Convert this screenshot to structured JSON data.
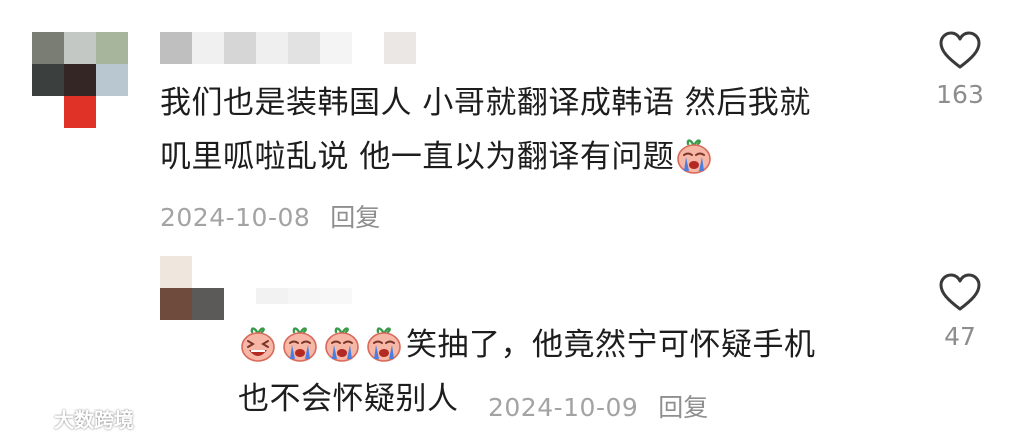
{
  "comment": {
    "avatar_pixels": [
      "#7a7d74",
      "#c4c8c5",
      "#a6b59b",
      "#3b3f3d",
      "#332624",
      "#b9c7d1",
      "#ffffff",
      "#e03226",
      "#ffffff"
    ],
    "name_pixels": [
      "#bfbfbf",
      "#f0f0f0",
      "#d6d6d6",
      "#efefef",
      "#e2e2e2",
      "#f4f4f4",
      "#ffffff",
      "#ebe7e4"
    ],
    "text_line1": "我们也是装韩国人 小哥就翻译成韩语 然后我就",
    "text_line2": "叽里呱啦乱说 他一直以为翻译有问题",
    "emoji_after_text": "crying-face-emoji",
    "date": "2024-10-08",
    "reply_label": "回复",
    "likes": "163",
    "like_icon": "heart-outline-icon"
  },
  "reply": {
    "avatar_pixels": [
      "#efe6dd",
      "#ffffff",
      "#6e4b3d",
      "#5c5a58"
    ],
    "name_pixels": [
      "#ffffff",
      "#f2f2f2",
      "#f6f6f6",
      "#f8f8f8"
    ],
    "emojis": [
      "laughing-face-emoji",
      "crying-face-emoji",
      "crying-face-emoji",
      "crying-face-emoji"
    ],
    "text_line1": "笑抽了，他竟然宁可怀疑手机",
    "text_line2": "也不会怀疑别人",
    "date": "2024-10-09",
    "reply_label": "回复",
    "likes": "47",
    "like_icon": "heart-outline-icon"
  },
  "watermark": {
    "text": "大数跨境",
    "logo": "watermark-logo-icon"
  },
  "colors": {
    "text": "#1d1d1d",
    "meta": "#a3a3a3",
    "emoji_skin": "#f6b7a6",
    "tear": "#4a7ee0"
  }
}
